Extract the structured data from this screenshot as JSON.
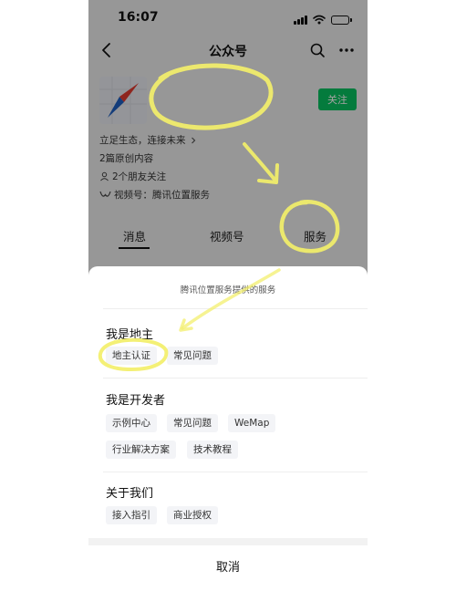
{
  "status_bar": {
    "time": "16:07",
    "icons": [
      "signal-icon",
      "wifi-icon",
      "battery-icon"
    ]
  },
  "nav": {
    "title": "公众号",
    "icons": [
      "back-icon",
      "search-icon",
      "more-icon"
    ]
  },
  "account": {
    "follow_label": "关注",
    "slogan": "立足生态，连接未来",
    "original_count": "2篇原创内容",
    "friends_following": "2个朋友关注",
    "video_channel": "视频号：腾讯位置服务"
  },
  "tabs": [
    {
      "label": "消息",
      "active": true
    },
    {
      "label": "视频号",
      "active": false
    },
    {
      "label": "服务",
      "active": false
    }
  ],
  "sheet": {
    "header": "腾讯位置服务提供的服务",
    "sections": [
      {
        "title": "我是地主",
        "items": [
          "地主认证",
          "常见问题"
        ]
      },
      {
        "title": "我是开发者",
        "items": [
          "示例中心",
          "常见问题",
          "WeMap",
          "行业解决方案",
          "技术教程"
        ]
      },
      {
        "title": "关于我们",
        "items": [
          "接入指引",
          "商业授权"
        ]
      }
    ],
    "cancel_label": "取消"
  },
  "colors": {
    "accent_green": "#07c160",
    "overlay": "rgba(0,0,0,0.36)",
    "highlight_yellow": "#f3ef6a",
    "chip_background": "#f3f4f7"
  }
}
